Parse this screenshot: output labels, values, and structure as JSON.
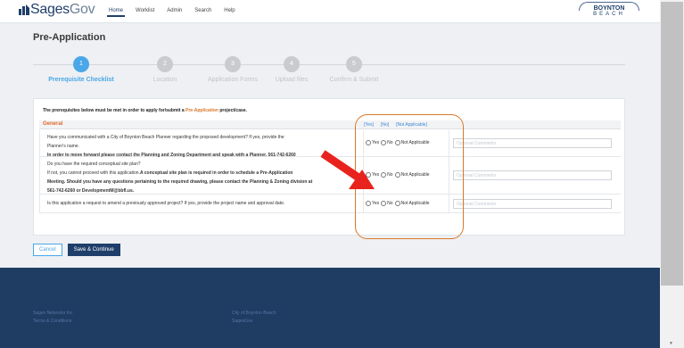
{
  "header": {
    "logo": {
      "brand": "Sages",
      "brand2": "Gov"
    },
    "nav": [
      "Home",
      "Worklist",
      "Admin",
      "Search",
      "Help"
    ],
    "city_logo": {
      "line1": "BOYNTON",
      "line2": "BEACH"
    }
  },
  "page_title": "Pre-Application",
  "wizard": {
    "steps": [
      {
        "num": "1",
        "label": "Prerequisite Checklist"
      },
      {
        "num": "2",
        "label": "Location"
      },
      {
        "num": "3",
        "label": "Application Forms"
      },
      {
        "num": "4",
        "label": "Upload files"
      },
      {
        "num": "5",
        "label": "Confirm & Submit"
      }
    ]
  },
  "checklist": {
    "intro_pre": "The prerequisites below must be met in order to apply for/submit a ",
    "intro_hl": "Pre-Application",
    "intro_post": " project/case.",
    "section": "General",
    "links": [
      "[Yes]",
      "[No]",
      "[Not Applicable]"
    ],
    "radio_labels": [
      "Yes",
      "No",
      "Not Applicable"
    ],
    "comment_placeholder": "Optional Comments",
    "questions": [
      {
        "l1": "Have you communicated with a City of Boynton Beach Planner regarding the proposed development? If yes, provide the",
        "l2": "Planner's name.",
        "bold": "In order to move forward please contact the Planning and Zoning Department and speak with a Planner. 561-742-6260"
      },
      {
        "l1": "Do you have the required conceptual site plan?",
        "l2": "If not, you cannot proceed with this application.",
        "bold_a": "A conceptual site plan is required in order to schedule a Pre-Application",
        "bold_b": "Meeting. Should you have any questions pertaining to the required drawing, please contact the Planning & Zoning division at",
        "bold_c": "561-742-6260 or DevelopmentM@bbfl.us."
      },
      {
        "l1": "Is this application a request to amend a previously approved project? If yes, provide the project name and approval date."
      }
    ]
  },
  "buttons": {
    "cancel": "Cancel",
    "save": "Save & Continue"
  },
  "footer": {
    "col1": [
      "Sages Networks Inc",
      "Terms & Conditions"
    ],
    "col2": [
      "City of Boynton Beach",
      "SagesGov"
    ]
  },
  "colors": {
    "accent": "#4aa7e8",
    "brand": "#1f3f6a",
    "section": "#e06a2c",
    "annotation": "#d9782a",
    "arrow": "#e8231e"
  }
}
